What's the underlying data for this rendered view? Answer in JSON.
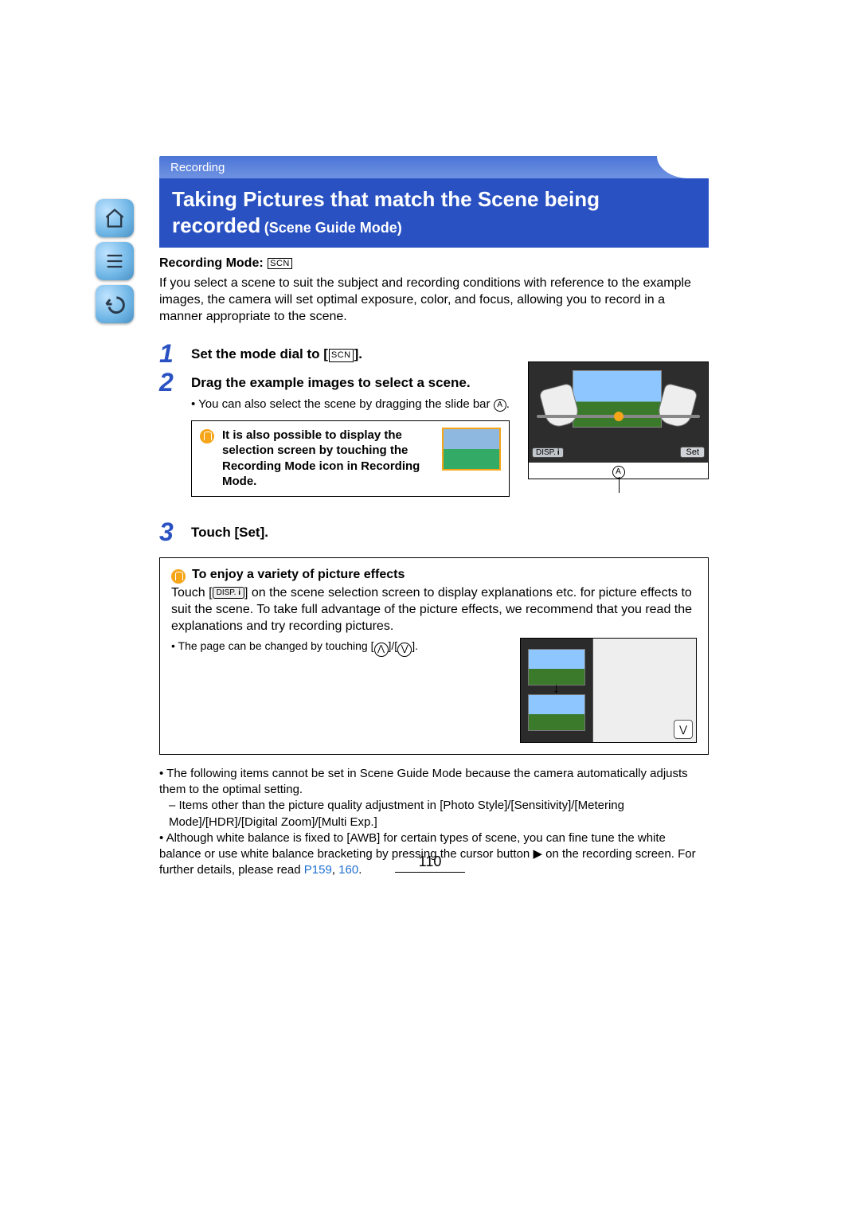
{
  "tab": {
    "label": "Recording"
  },
  "title": {
    "line1": "Taking Pictures that match the Scene being",
    "line2_strong": "recorded",
    "line2_rest": " (Scene Guide Mode)"
  },
  "nav": {
    "home": "home-icon",
    "toc": "toc-icon",
    "back": "back-icon"
  },
  "recMode": {
    "label": "Recording Mode: ",
    "badge": "SCN"
  },
  "intro": "If you select a scene to suit the subject and recording conditions with reference to the example images, the camera will set optimal exposure, color, and focus, allowing you to record in a manner appropriate to the scene.",
  "steps": {
    "s1": {
      "num": "1",
      "title_pre": "Set the mode dial to [",
      "title_badge": "SCN",
      "title_post": "]."
    },
    "s2": {
      "num": "2",
      "title": "Drag the example images to select a scene.",
      "sub_pre": "• You can also select the scene by dragging the slide bar ",
      "sub_a": "A",
      "sub_post": ".",
      "tip": "It is also possible to display the selection screen by touching the Recording Mode icon in Recording Mode.",
      "shot": {
        "disp": "DISP.",
        "set": "Set",
        "a": "A"
      }
    },
    "s3": {
      "num": "3",
      "title": "Touch [Set]."
    }
  },
  "box": {
    "lead": "To enjoy a variety of picture effects",
    "para_pre": "Touch [",
    "para_disp": "DISP.",
    "para_mid": "] on the scene selection screen to display explanations etc. for picture effects to suit the scene. To take full advantage of the picture effects, we recommend that you read the explanations and try recording pictures.",
    "note_pre": "• The page can be changed by touching [",
    "note_up": "⋀",
    "note_mid": "]/[",
    "note_down": "⋁",
    "note_post": "]."
  },
  "notes": {
    "n1": "The following items cannot be set in Scene Guide Mode because the camera automatically adjusts them to the optimal setting.",
    "n1a": "Items other than the picture quality adjustment in [Photo Style]/[Sensitivity]/[Metering Mode]/[HDR]/[Digital Zoom]/[Multi Exp.]",
    "n2_pre": "Although white balance is fixed to [AWB] for certain types of scene, you can fine tune the white balance or use white balance bracketing by pressing the cursor button ▶ on the recording screen. For further details, please read ",
    "n2_link1": "P159",
    "n2_sep": ", ",
    "n2_link2": "160",
    "n2_post": "."
  },
  "pageNumber": "110"
}
